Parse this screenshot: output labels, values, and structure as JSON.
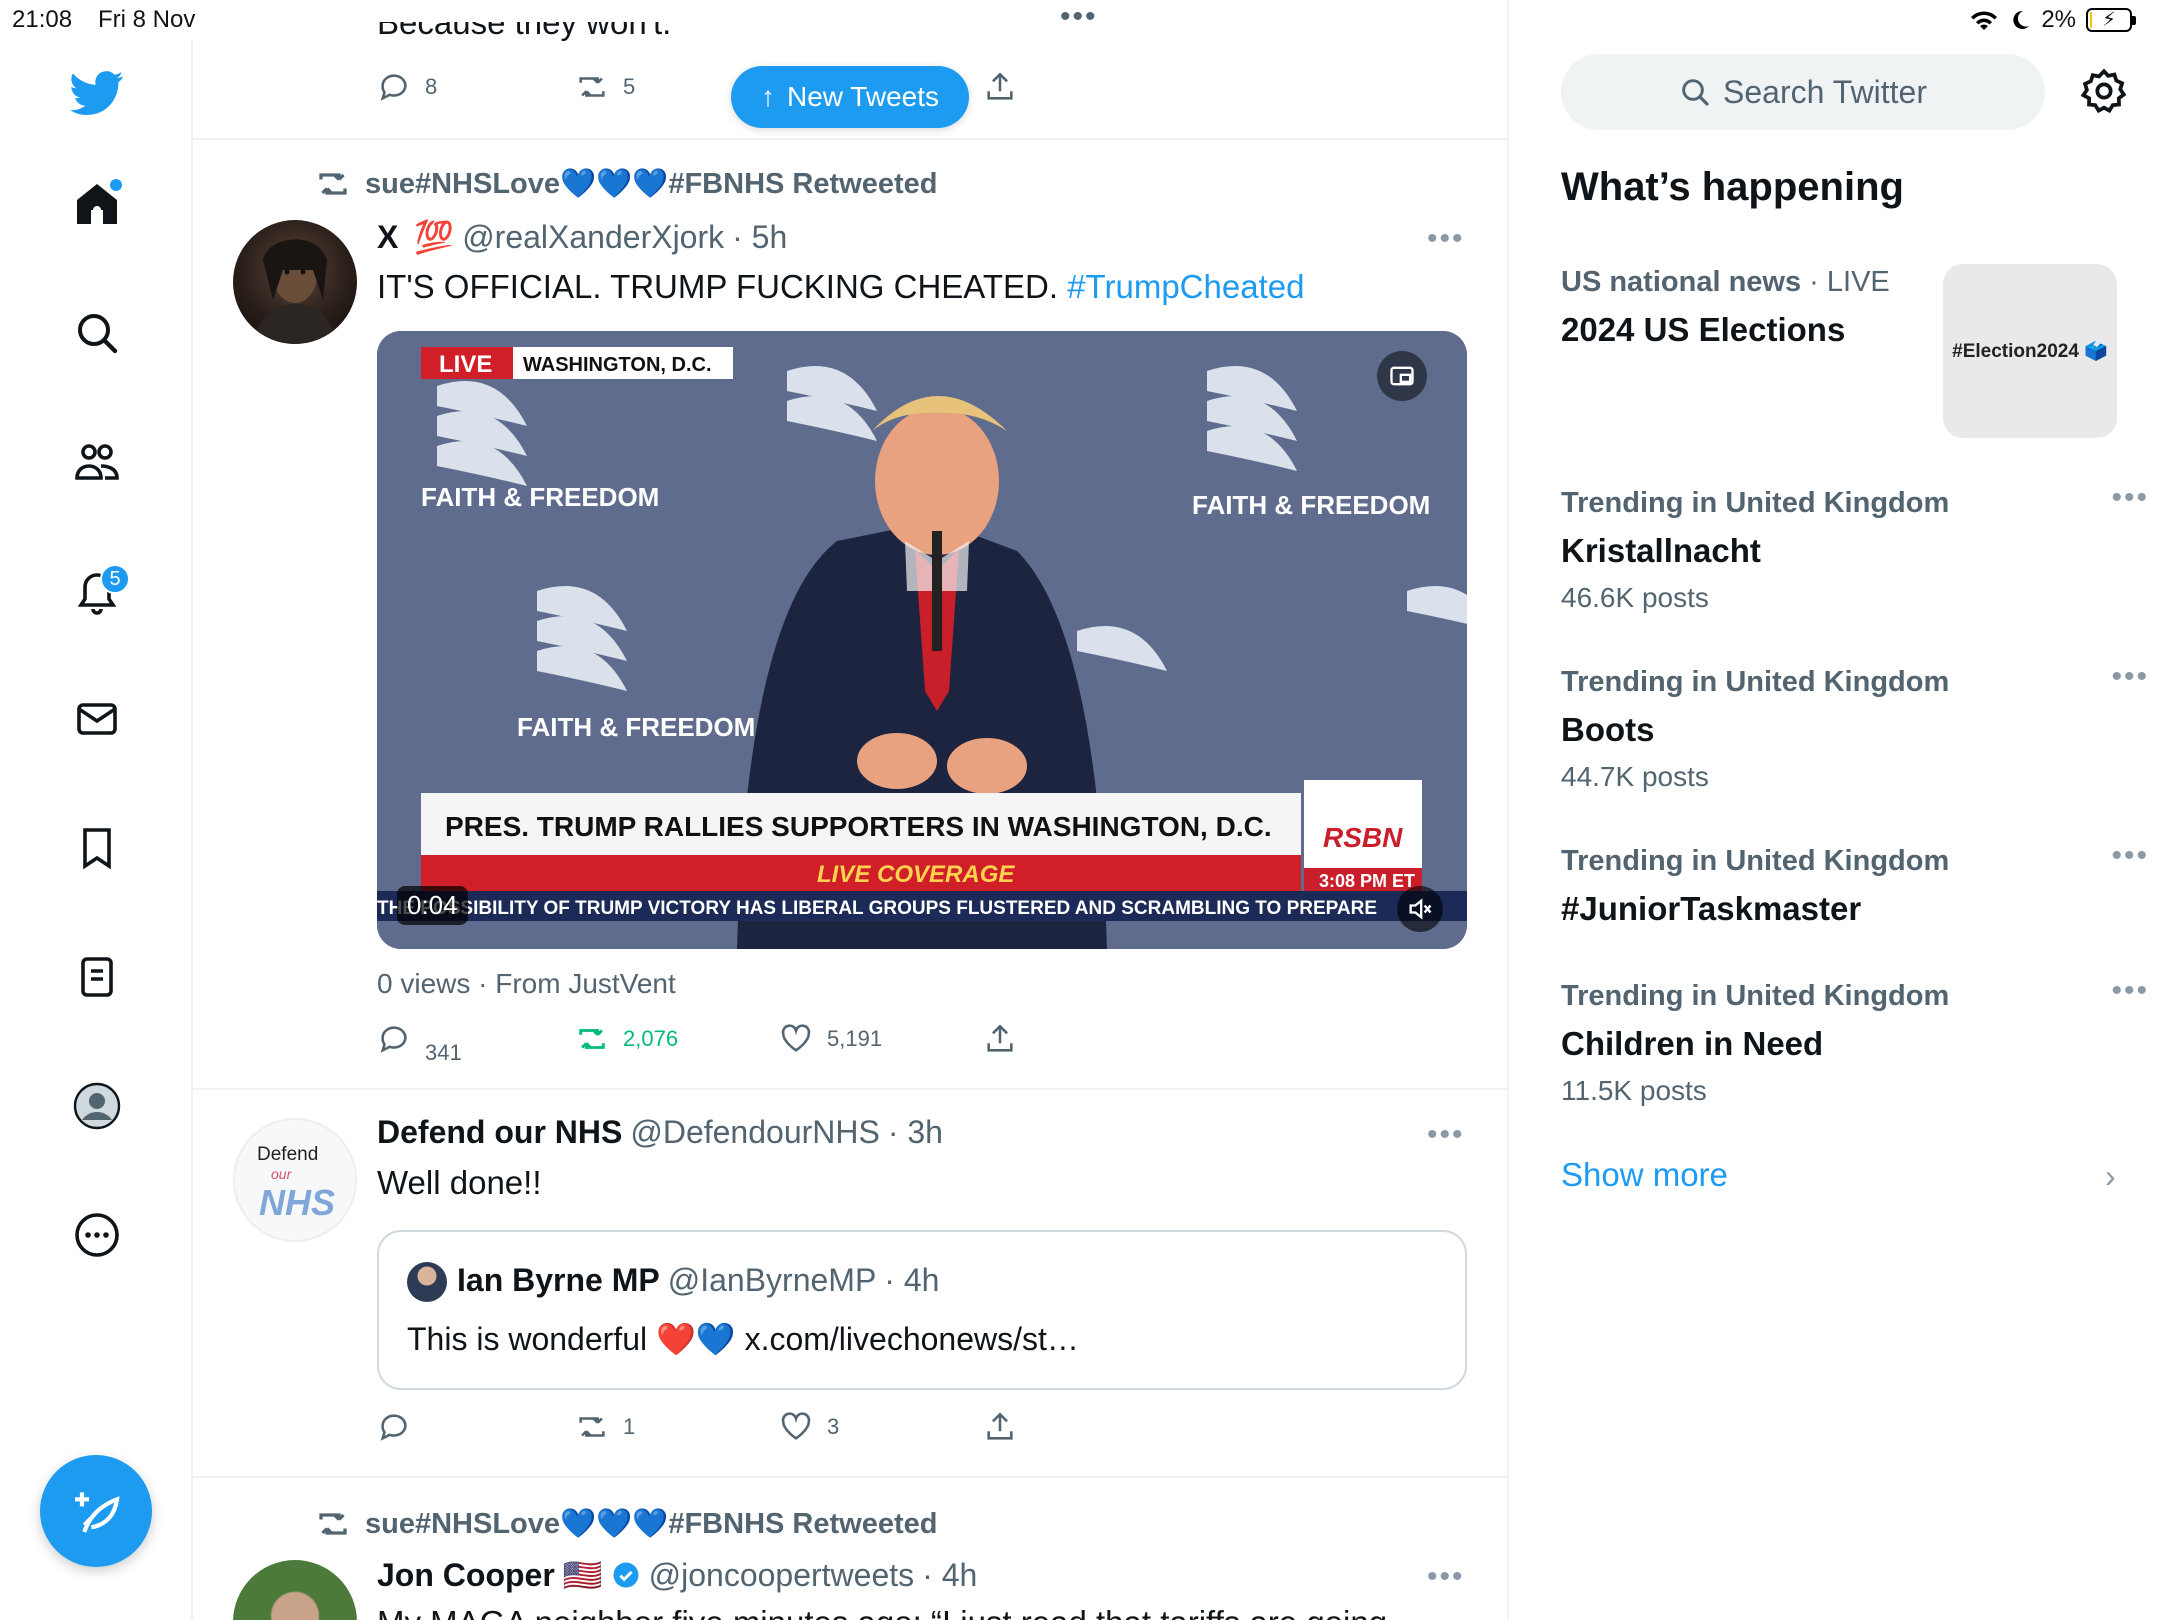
{
  "status_bar": {
    "time": "21:08",
    "date": "Fri 8 Nov",
    "battery": "2%",
    "battery_level": 0.02
  },
  "nav": {
    "notifications_badge": "5"
  },
  "feed": {
    "top_tweet": {
      "partial_text": "Because they won't.",
      "replies": "8",
      "retweets": "5"
    },
    "new_tweets_label": "New Tweets",
    "tweet1": {
      "retweeted_by": "sue#NHSLove💙💙💙#FBNHS Retweeted",
      "name": "X",
      "name_emoji": "💯",
      "handle": "@realXanderXjork",
      "time": "· 5h",
      "text": "IT'S OFFICIAL. TRUMP FUCKING CHEATED.",
      "hashtag": "#TrumpCheated",
      "media": {
        "live_badge": "LIVE",
        "location": "WASHINGTON, D.C.",
        "backdrop_text": "FAITH & FREEDOM",
        "chyron": "PRES. TRUMP RALLIES SUPPORTERS IN WASHINGTON, D.C.",
        "live_coverage": "LIVE COVERAGE",
        "ticker": "THE POSSIBILITY OF TRUMP VICTORY HAS LIBERAL GROUPS FLUSTERED AND SCRAMBLING TO PREPARE",
        "network": "RSBN",
        "clock": "3:08 PM ET",
        "duration": "0:04"
      },
      "views": "0 views · From JustVent",
      "replies": "341",
      "retweets": "2,076",
      "likes": "5,191"
    },
    "tweet2": {
      "name": "Defend our NHS",
      "handle": "@DefendourNHS",
      "time": "· 3h",
      "text": "Well done!!",
      "avatar_text": "Defend",
      "avatar_sub": "our",
      "avatar_logo": "NHS",
      "quote": {
        "name": "Ian Byrne MP",
        "handle": "@IanByrneMP",
        "time": "· 4h",
        "text": "This is wonderful ❤️💙 x.com/livechonews/st…"
      },
      "retweets": "1",
      "likes": "3"
    },
    "tweet3": {
      "retweeted_by": "sue#NHSLove💙💙💙#FBNHS Retweeted",
      "name": "Jon Cooper",
      "flag": "🇺🇸",
      "handle": "@joncoopertweets",
      "time": "· 4h",
      "text": "My MAGA neighbor five minutes ago: “I just read that tariffs are going"
    }
  },
  "sidebar": {
    "search_placeholder": "Search Twitter",
    "heading": "What’s happening",
    "trends": [
      {
        "context": "US national news",
        "live": " · LIVE",
        "name": "2024 US Elections",
        "image_label": "#Election2024 🗳️"
      },
      {
        "context": "Trending in United Kingdom",
        "name": "Kristallnacht",
        "count": "46.6K posts"
      },
      {
        "context": "Trending in United Kingdom",
        "name": "Boots",
        "count": "44.7K posts"
      },
      {
        "context": "Trending in United Kingdom",
        "name": "#JuniorTaskmaster",
        "count": ""
      },
      {
        "context": "Trending in United Kingdom",
        "name": "Children in Need",
        "count": "11.5K posts"
      }
    ],
    "show_more": "Show more"
  }
}
